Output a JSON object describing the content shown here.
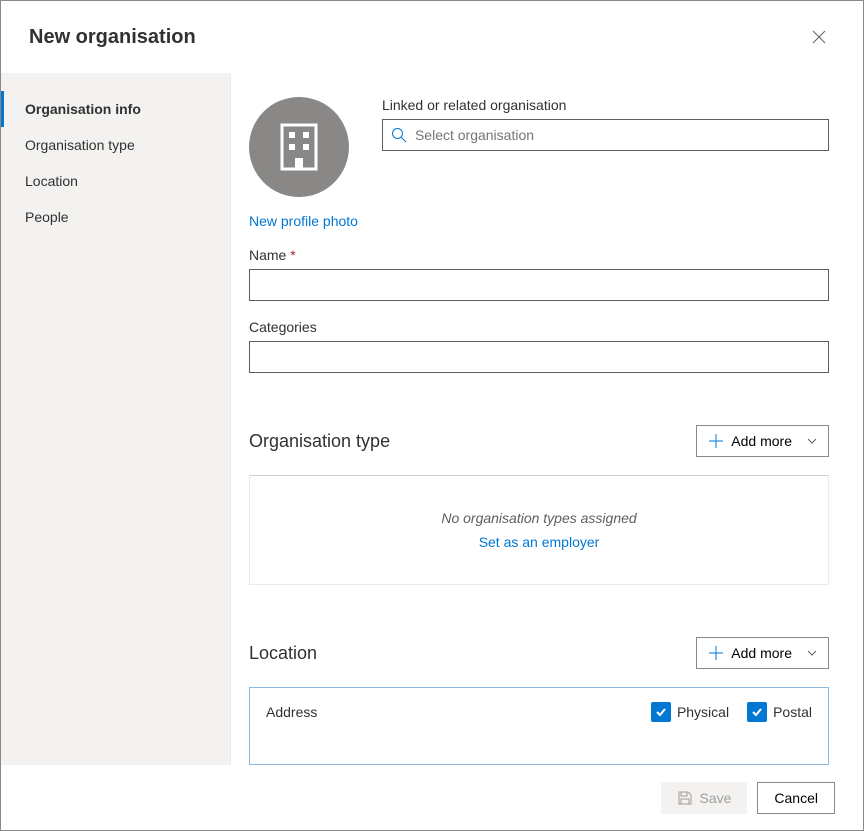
{
  "header": {
    "title": "New organisation"
  },
  "sidebar": {
    "items": [
      {
        "label": "Organisation info",
        "active": true
      },
      {
        "label": "Organisation type",
        "active": false
      },
      {
        "label": "Location",
        "active": false
      },
      {
        "label": "People",
        "active": false
      }
    ]
  },
  "main": {
    "linked_org_label": "Linked or related organisation",
    "linked_org_placeholder": "Select organisation",
    "new_photo_link": "New profile photo",
    "name_label": "Name",
    "name_required": "*",
    "name_value": "",
    "categories_label": "Categories",
    "categories_value": "",
    "org_type_section": {
      "title": "Organisation type",
      "add_more": "Add more",
      "empty_text": "No organisation types assigned",
      "employer_link": "Set as an employer"
    },
    "location_section": {
      "title": "Location",
      "add_more": "Add more",
      "address_label": "Address",
      "physical_label": "Physical",
      "physical_checked": true,
      "postal_label": "Postal",
      "postal_checked": true
    }
  },
  "footer": {
    "save": "Save",
    "cancel": "Cancel"
  }
}
